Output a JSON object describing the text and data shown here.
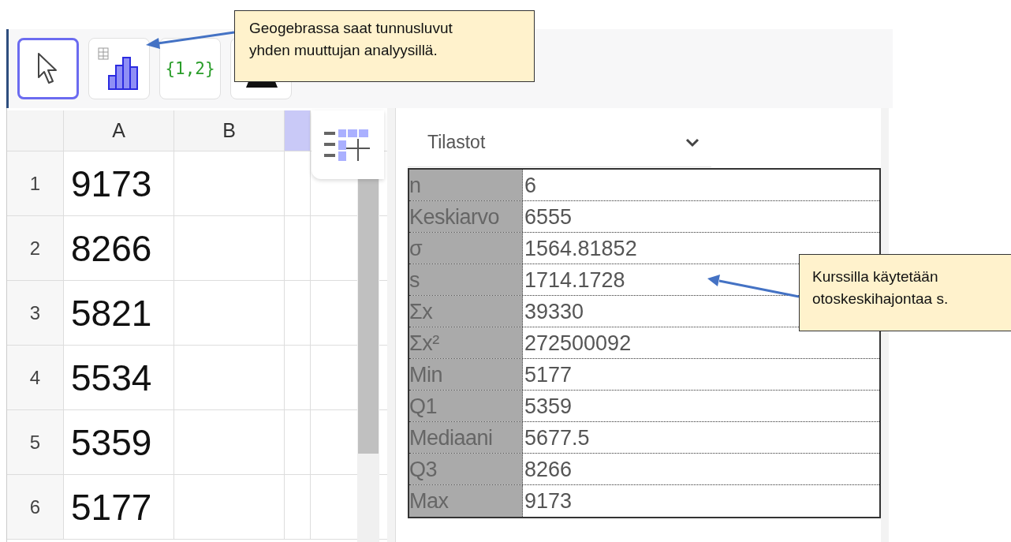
{
  "toolbar": {
    "tools": [
      {
        "kind": "move",
        "selected": true
      },
      {
        "kind": "analysis",
        "selected": false
      },
      {
        "kind": "list",
        "label": "{1,2}",
        "selected": false
      },
      {
        "kind": "other",
        "selected": false
      }
    ]
  },
  "spreadsheet": {
    "columns": [
      "A",
      "B"
    ],
    "rows": [
      {
        "number": "1",
        "A": "9173"
      },
      {
        "number": "2",
        "A": "8266"
      },
      {
        "number": "3",
        "A": "5821"
      },
      {
        "number": "4",
        "A": "5534"
      },
      {
        "number": "5",
        "A": "5359"
      },
      {
        "number": "6",
        "A": "5177"
      }
    ]
  },
  "statistics": {
    "dropdown": "Tilastot",
    "rows": [
      {
        "label": "n",
        "value": "6"
      },
      {
        "label": "Keskiarvo",
        "value": "6555"
      },
      {
        "label": "σ",
        "value": "1564.81852"
      },
      {
        "label": "s",
        "value": "1714.1728"
      },
      {
        "label": "Σx",
        "value": "39330"
      },
      {
        "label": "Σx²",
        "value": "272500092"
      },
      {
        "label": "Min",
        "value": "5177"
      },
      {
        "label": "Q1",
        "value": "5359"
      },
      {
        "label": "Mediaani",
        "value": "5677.5"
      },
      {
        "label": "Q3",
        "value": "8266"
      },
      {
        "label": "Max",
        "value": "9173"
      }
    ]
  },
  "annotations": [
    {
      "lines": [
        "Geogebrassa saat tunnusluvut",
        "yhden muuttujan analyysillä."
      ]
    },
    {
      "lines": [
        "Kurssilla käytetään",
        "otoskeskihajontaa s."
      ]
    }
  ]
}
